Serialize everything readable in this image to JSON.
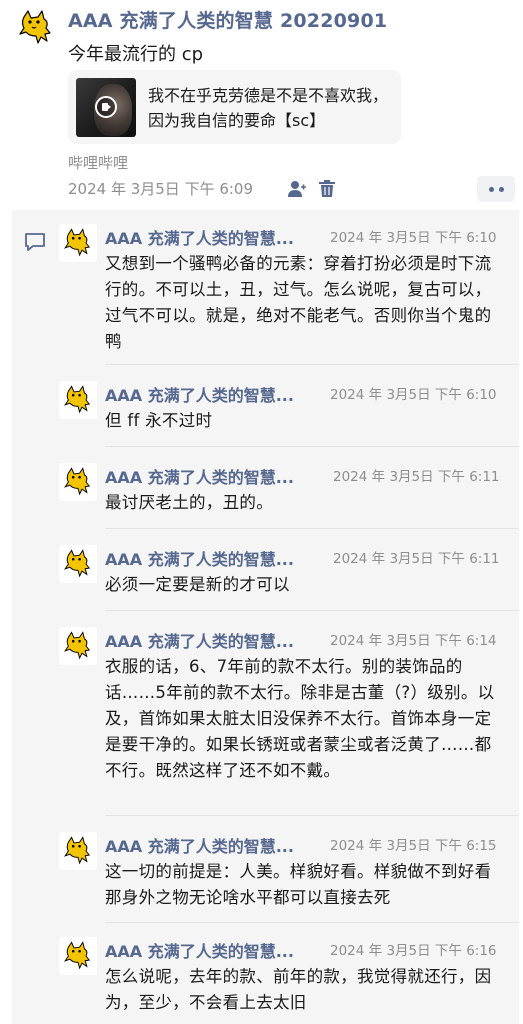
{
  "post": {
    "author": "AAA 充满了人类的智慧 20220901",
    "text": "今年最流行的 cp",
    "link_card": {
      "title": "我不在乎克劳德是不是不喜欢我，因为我自信的要命【sc】",
      "icon": "video-play-icon"
    },
    "source": "哔哩哔哩",
    "time": "2024 年 3月5日 下午 6:09",
    "actions": {
      "visibility_icon": "person-visibility-icon",
      "delete_icon": "trash-icon",
      "more_icon": "more-dots-icon"
    }
  },
  "comments_section": {
    "icon": "comment-icon",
    "comments": [
      {
        "name": "AAA 充满了人类的智慧...",
        "time": "2024 年 3月5日 下午 6:10",
        "text": "又想到一个骚鸭必备的元素：穿着打扮必须是时下流行的。不可以土，丑，过气。怎么说呢，复古可以，过气不可以。就是，绝对不能老气。否则你当个鬼的鸭"
      },
      {
        "name": "AAA 充满了人类的智慧...",
        "time": "2024 年 3月5日 下午 6:10",
        "text": "但 ff 永不过时"
      },
      {
        "name": "AAA 充满了人类的智慧...",
        "time": "2024 年 3月5日 下午 6:11",
        "text": "最讨厌老土的，丑的。"
      },
      {
        "name": "AAA 充满了人类的智慧...",
        "time": "2024 年 3月5日 下午 6:11",
        "text": "必须一定要是新的才可以"
      },
      {
        "name": "AAA 充满了人类的智慧...",
        "time": "2024 年 3月5日 下午 6:14",
        "text": "衣服的话，6、7年前的款不太行。别的装饰品的话……5年前的款不太行。除非是古董（?）级别。以及，首饰如果太脏太旧没保养不太行。首饰本身一定是要干净的。如果长锈斑或者蒙尘或者泛黄了……都不行。既然这样了还不如不戴。"
      },
      {
        "name": "AAA 充满了人类的智慧...",
        "time": "2024 年 3月5日 下午 6:15",
        "text": "这一切的前提是：人美。样貌好看。样貌做不到好看那身外之物无论啥水平都可以直接去死"
      },
      {
        "name": "AAA 充满了人类的智慧...",
        "time": "2024 年 3月5日 下午 6:16",
        "text": "怎么说呢，去年的款、前年的款，我觉得就还行，因为，至少，不会看上去太旧"
      }
    ]
  },
  "colors": {
    "author_link": "#56688f",
    "meta_gray": "#8e8e8e",
    "comments_bg": "#f5f5f5",
    "avatar_yellow": "#f3c400"
  }
}
